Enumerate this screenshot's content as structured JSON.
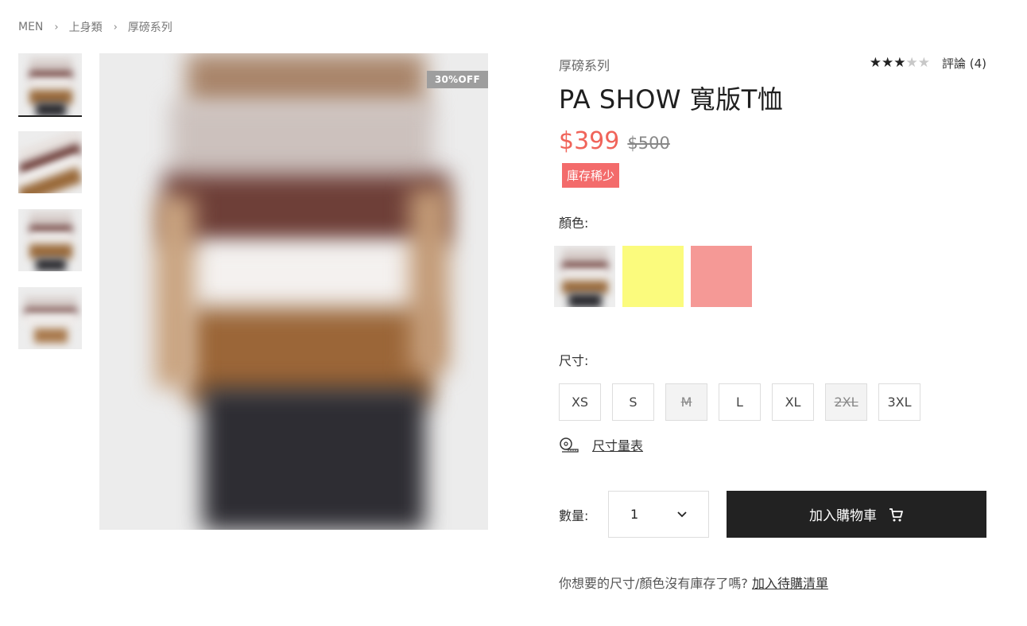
{
  "breadcrumb": {
    "items": [
      "MEN",
      "上身類",
      "厚磅系列"
    ],
    "separator": "›"
  },
  "gallery": {
    "thumbnail_count": 4,
    "active_index": 0,
    "badge": "30%OFF"
  },
  "product": {
    "series": "厚磅系列",
    "title": "PA SHOW 寬版T恤",
    "price": "$399",
    "original_price": "$500",
    "stock_badge": "庫存稀少",
    "rating": 3,
    "rating_max": 5,
    "reviews_label": "評論 (4)"
  },
  "options": {
    "color_label": "顏色:",
    "colors": [
      {
        "name": "stripe-photo",
        "hex": "#8a5a3c"
      },
      {
        "name": "yellow",
        "hex": "#fbfb7d"
      },
      {
        "name": "pink",
        "hex": "#f59996"
      }
    ],
    "size_label": "尺寸:",
    "sizes": [
      {
        "label": "XS",
        "available": true
      },
      {
        "label": "S",
        "available": true
      },
      {
        "label": "M",
        "available": false
      },
      {
        "label": "L",
        "available": true
      },
      {
        "label": "XL",
        "available": true
      },
      {
        "label": "2XL",
        "available": false
      },
      {
        "label": "3XL",
        "available": true
      }
    ],
    "size_chart_label": "尺寸量表"
  },
  "purchase": {
    "qty_label": "數量:",
    "qty_value": "1",
    "add_to_cart_label": "加入購物車"
  },
  "wishlist": {
    "text": "你想要的尺寸/顏色沒有庫存了嗎?",
    "link": "加入待購清單"
  },
  "colors": {
    "accent_price": "#f0645a",
    "stock_badge": "#f36b6b",
    "button_dark": "#222222",
    "discount_badge": "#9e9e9e"
  }
}
